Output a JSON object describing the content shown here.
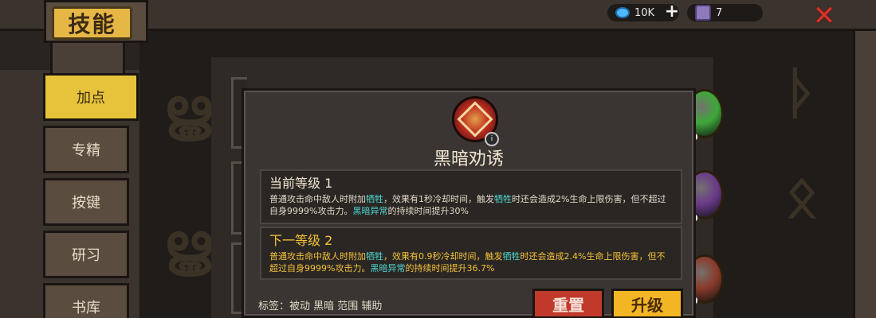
{
  "header": {
    "title": "技能",
    "gems": "10K",
    "materials": "7",
    "plus": "+",
    "close": "✕"
  },
  "tabs": [
    {
      "label": "加点",
      "active": true
    },
    {
      "label": "专精",
      "active": false
    },
    {
      "label": "按键",
      "active": false
    },
    {
      "label": "研习",
      "active": false
    },
    {
      "label": "书库",
      "active": false
    }
  ],
  "dialog": {
    "skill_name": "黑暗劝诱",
    "info": "i",
    "current": {
      "heading": "当前等级 1",
      "desc_a": "普通攻击命中敌人时附加",
      "kw1": "牺牲",
      "desc_b": "，效果有1秒冷却时间，触发",
      "kw2": "牺牲",
      "desc_c": "时还会造成2%生命上限伤害，但不超过自身9999%攻击力。",
      "kw3": "黑暗异常",
      "desc_d": "的持续时间提升30%"
    },
    "next": {
      "heading": "下一等级 2",
      "desc_a": "普通攻击命中敌人时附加",
      "kw1": "牺牲",
      "desc_b": "，效果有0.9秒冷却时间，触发",
      "kw2": "牺牲",
      "desc_c": "时还会造成2.4%生命上限伤害，但不超过自身9999%攻击力。",
      "kw3": "黑暗异常",
      "desc_d": "的持续时间提升36.7%"
    },
    "tags": "标签：被动 黑暗 范围 辅助",
    "reset_label": "重置",
    "upgrade_label": "升级"
  },
  "orbs": [
    {
      "level": "0",
      "color": "#3fa83a"
    },
    {
      "level": "0",
      "color": "#6a3a8a"
    },
    {
      "level": "0",
      "color": "#8a3a2a"
    }
  ],
  "colors": {
    "accent_yellow": "#e6c33a",
    "keyword": "#4fd6d0",
    "next_level_text": "#f5c23a",
    "reset_red": "#c0392b",
    "upgrade_gold": "#f2b523",
    "close_red": "#d8322a"
  }
}
